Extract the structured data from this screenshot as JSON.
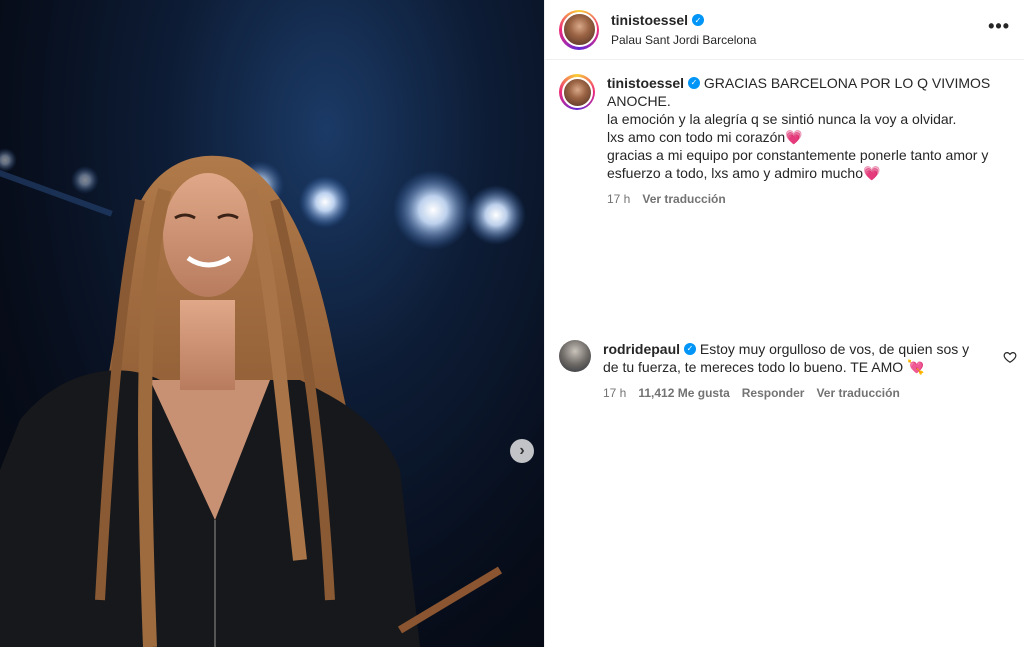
{
  "post": {
    "author": "tinistoessel",
    "location": "Palau Sant Jordi Barcelona",
    "more_label": "•••",
    "next_label": "›"
  },
  "caption": {
    "author": "tinistoessel",
    "lines": [
      "GRACIAS BARCELONA POR LO Q VIVIMOS ANOCHE.",
      "la emoción y la alegría q se sintió nunca la voy a olvidar.",
      "lxs amo con todo mi corazón💗",
      "gracias a mi equipo por constantemente ponerle tanto amor y esfuerzo a todo, lxs amo y admiro mucho💗"
    ],
    "time": "17 h",
    "translate": "Ver traducción"
  },
  "comment": {
    "author": "rodridepaul",
    "text": "Estoy muy orgulloso de vos, de quien sos y de tu fuerza, te mereces todo lo bueno. TE AMO 💘",
    "time": "17 h",
    "likes": "11,412 Me gusta",
    "reply": "Responder",
    "translate": "Ver traducción"
  },
  "colors": {
    "verified": "#0095f6",
    "meta": "#737373"
  },
  "icons": [
    "verified-badge-icon",
    "more-options-icon",
    "next-arrow-icon",
    "like-heart-icon"
  ]
}
